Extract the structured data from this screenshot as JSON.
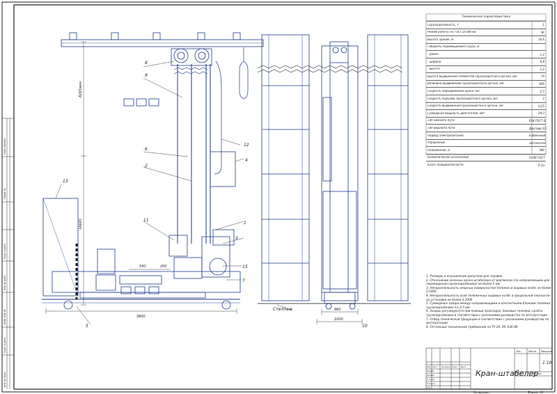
{
  "drawing": {
    "title": "Кран-штабелер",
    "scale": "1:10",
    "format": "Формат А1",
    "copied": "Копировал",
    "stamp_cols": [
      "Лит.",
      "Масса",
      "Масштаб"
    ],
    "stamp_row": [
      "Лист",
      "Листов"
    ],
    "stamp_sign_rows": [
      "Изм.",
      "Лист",
      "№ докум.",
      "Подп.",
      "Дата"
    ],
    "stamp_roles": [
      "Разраб.",
      "Провер.",
      "Т.контр.",
      "",
      "Н.контр.",
      "Утв."
    ],
    "left_strip": [
      "Перв. примен.",
      "Справ. №",
      "Подп. и дата",
      "Инв. № дубл.",
      "Взам. инв. №",
      "Подп. и дата",
      "Инв. № подл."
    ]
  },
  "spec_table": {
    "header": "Техническая характеристика",
    "rows": [
      {
        "label": "Грузоподъёмность, т",
        "value": "1"
      },
      {
        "label": "Режим работы по ГОСТ 25546-82",
        "value": "3К"
      },
      {
        "label": "Высота здания, м",
        "value": "16,6"
      },
      {
        "label": "Габариты перемещаемого груза, м",
        "value": ""
      },
      {
        "label": "- длина",
        "value": "1,2"
      },
      {
        "label": "- ширина",
        "value": "0,8"
      },
      {
        "label": "- высота",
        "value": "1,2"
      },
      {
        "label": "Высота выдвижения элементов грузозахватного органа, мм",
        "value": "70"
      },
      {
        "label": "Величина выдвижения грузозахватного органа, мм",
        "value": "900"
      },
      {
        "label": "Скорость передвижения крана, м/с",
        "value": "2,5"
      },
      {
        "label": "Скорость подъёма грузозахватного органа, м/с",
        "value": "2"
      },
      {
        "label": "Скорость выдвижения грузозахватного органа, м/с",
        "value": "0,25"
      },
      {
        "label": "Суммарная мощность двигателей, кВт",
        "value": "24,3"
      },
      {
        "label": "Тип нижнего пути",
        "value": "Р24 ГОСТ 6368-82"
      },
      {
        "label": "Тип верхнего пути",
        "value": "Двутавр 10 ГОСТ 8239-72"
      },
      {
        "label": "Подвод электропитания",
        "value": "кабельный"
      },
      {
        "label": "Управление",
        "value": "автоматическое"
      },
      {
        "label": "Напряжение, В",
        "value": "380"
      },
      {
        "label": "Климатическое исполнение",
        "value": "УХЛ4 ГОСТ 15150-69"
      },
      {
        "label": "Класс пожароопасности",
        "value": "П-2а"
      }
    ]
  },
  "notes": [
    "1. Размеры и ограничение допуском для справок",
    "2. Отклонение колонны крана-штабелера от вертикали (по направляющим для перемещения грузоподъёмника) не более 5 мм",
    "3. Непараллельность опорных поверхностей тележек и ходовых колёс не более 2:1000",
    "4. Непараллельность осей тележечных ходовых колёс в продольной плоскости их установки не более 2:1000",
    "5. Суммарные зазоры между направляющими и контактными блоками тележки грузоподъёмника ±1,0,5 мм",
    "6. Зазоры регулируются при помощи прокладок. Боковые тележки, колёса грузоподъёмника в соответствии с указаниями руководства по эксплуатации",
    "7. Отвод технической продукции в соответствии с указаниями руководства по эксплуатации",
    "8. Остальные технические требования по ТУ 24. 09. 636-86"
  ],
  "dimensions": {
    "height_top": "8265мин",
    "height_main": "16645",
    "span_540": "540",
    "span_200": "200",
    "base_length": "3900",
    "width_960": "960",
    "width_1000": "1000"
  },
  "labels": {
    "rack_label": "Стеллаж",
    "callouts": [
      "8",
      "9",
      "6",
      "2",
      "11",
      "1",
      "3",
      "4",
      "12",
      "13",
      "15",
      "7",
      "5",
      "10"
    ]
  }
}
